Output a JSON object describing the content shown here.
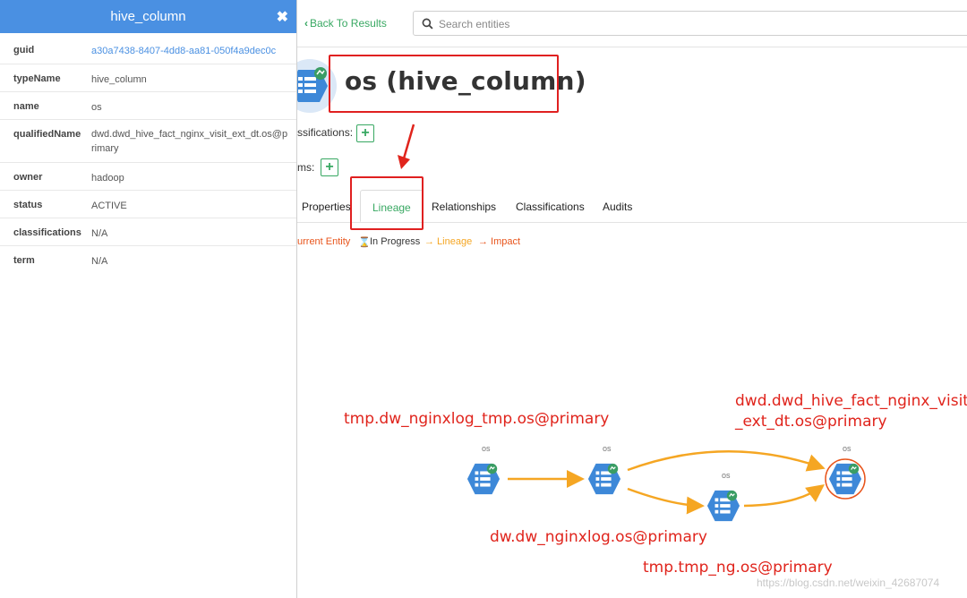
{
  "panel": {
    "title": "hive_column",
    "close_icon": "✖",
    "rows": [
      {
        "key": "guid",
        "value": "a30a7438-8407-4dd8-aa81-050f4a9dec0c"
      },
      {
        "key": "typeName",
        "value": "hive_column"
      },
      {
        "key": "name",
        "value": "os"
      },
      {
        "key": "qualifiedName",
        "value": "dwd.dwd_hive_fact_nginx_visit_ext_dt.os@primary"
      },
      {
        "key": "owner",
        "value": "hadoop"
      },
      {
        "key": "status",
        "value": "ACTIVE"
      },
      {
        "key": "classifications",
        "value": "N/A"
      },
      {
        "key": "term",
        "value": "N/A"
      }
    ]
  },
  "header": {
    "back_label": "Back To Results",
    "search_placeholder": "Search entities"
  },
  "entity": {
    "title": "os (hive_column)",
    "classifications_label": "ssifications:",
    "terms_label": "ms:",
    "plus": "+"
  },
  "tabs": [
    {
      "label": "Properties"
    },
    {
      "label": "Lineage",
      "active": true
    },
    {
      "label": "Relationships"
    },
    {
      "label": "Classifications"
    },
    {
      "label": "Audits"
    }
  ],
  "legend": {
    "current": "urrent Entity",
    "in_progress": "In Progress",
    "lineage": "→ Lineage",
    "impact": "→ Impact"
  },
  "graph": {
    "node_label": "os",
    "annotations": {
      "tmp_dw": "tmp.dw_nginxlog_tmp.os@primary",
      "dwd_line1": "dwd.dwd_hive_fact_nginx_visit",
      "dwd_line2": "_ext_dt.os@primary",
      "dw": "dw.dw_nginxlog.os@primary",
      "tmp_ng": "tmp.tmp_ng.os@primary"
    }
  },
  "watermark": "https://blog.csdn.net/weixin_42687074",
  "colors": {
    "accent_green": "#38a862",
    "panel_blue": "#4a90e2",
    "node_blue": "#3d88d8",
    "lineage_orange": "#f5a623",
    "impact_red": "#e8541b",
    "annotation_red": "#e0241c"
  }
}
